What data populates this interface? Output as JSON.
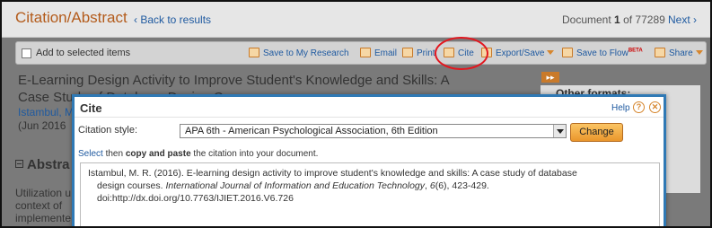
{
  "header": {
    "title": "Citation/Abstract",
    "back_link": "‹ Back to results",
    "document_prefix": "Document",
    "document_number": "1",
    "document_of": "of 77289",
    "next_link": "Next ›"
  },
  "toolbar": {
    "add_to_selected": "Add to selected items",
    "save_to_research": "Save to My Research",
    "email": "Email",
    "print": "Print",
    "cite": "Cite",
    "export_save": "Export/Save",
    "save_to_flow": "Save to Flow",
    "beta_badge": "BETA",
    "share": "Share",
    "cite_highlight_color": "#e3171f"
  },
  "article": {
    "title_line1": "E-Learning Design Activity to Improve Student's Knowledge and Skills: A",
    "title_line2": "Case Study of Database Design Courses",
    "author": "Istambul, M",
    "date": "(Jun 2016",
    "abstract_heading": "Abstra",
    "abstract_lines": [
      "Utilization u",
      "context of",
      "implemente"
    ]
  },
  "side_panel": {
    "arrows": "▸▸",
    "other_formats": "Other formats:"
  },
  "dialog": {
    "title": "Cite",
    "help": "Help",
    "help_icon": "question-icon",
    "close_icon": "close-icon",
    "citation_style_label": "Citation style:",
    "citation_style_value": "APA 6th - American Psychological Association, 6th Edition",
    "change_button": "Change",
    "instr_select": "Select",
    "instr_then": "then",
    "instr_bold": "copy and paste",
    "instr_rest": "the citation into your document.",
    "citation": {
      "line1": "Istambul, M. R. (2016). E-learning design activity to improve student's knowledge and skills: A case study of database",
      "line2_a": "design courses.",
      "line2_journal": "International Journal of Information and Education Technology",
      "line2_b": ",",
      "line2_volume": "6",
      "line2_c": "(6), 423-429.",
      "line3": "doi:http://dx.doi.org/10.7763/IJIET.2016.V6.726"
    }
  },
  "colors": {
    "accent_orange": "#b35b1b",
    "link_blue": "#1f5aa0",
    "dialog_border": "#2f79b5"
  }
}
